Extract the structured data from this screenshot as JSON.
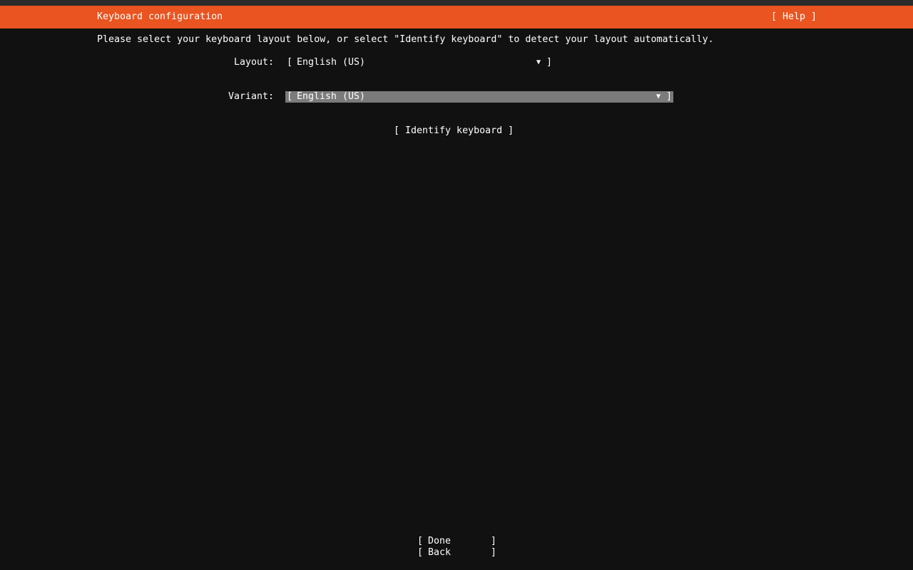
{
  "header": {
    "title": "Keyboard configuration",
    "help": "[ Help ]"
  },
  "instructions": "Please select your keyboard layout below, or select \"Identify keyboard\" to detect your layout automatically.",
  "form": {
    "layout_label": "Layout:",
    "layout_value": "English (US)",
    "variant_label": "Variant:",
    "variant_value": "English (US)",
    "bracket_open": "[",
    "bracket_close": "]",
    "arrow": "▼"
  },
  "identify_button": "[ Identify keyboard ]",
  "footer": {
    "done_label": "Done",
    "back_label": "Back"
  },
  "colors": {
    "header_bg": "#e95420",
    "background": "#111111",
    "focus_bg": "#7b7b7b",
    "text": "#ffffff"
  }
}
